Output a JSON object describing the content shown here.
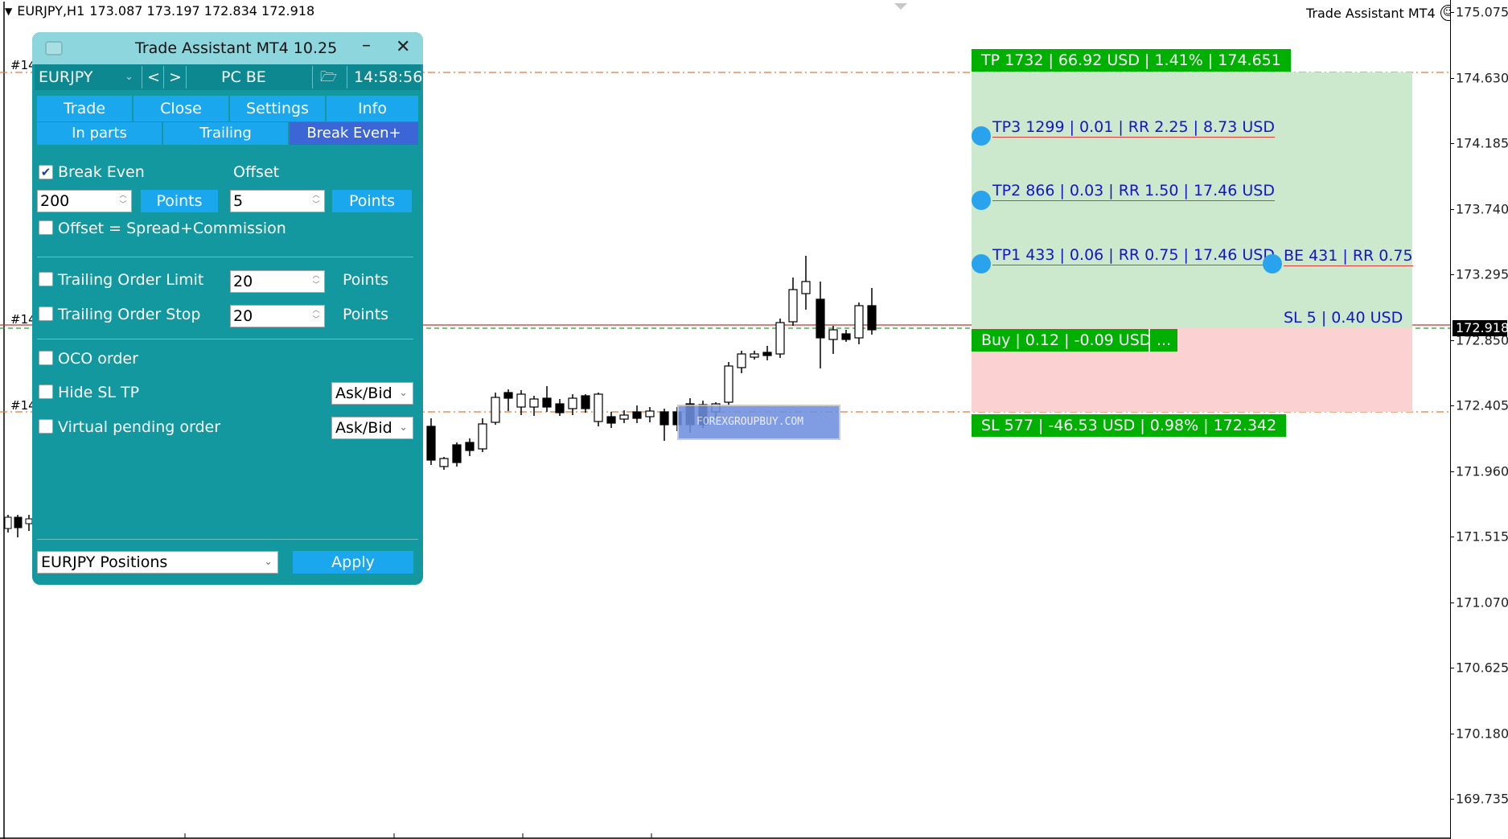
{
  "chart": {
    "header_symbol": "EURJPY,H1",
    "header_ohlc": "173.087 173.197 172.834 172.918",
    "title_right": "Trade Assistant MT4",
    "current_price": "172.918",
    "left_tags": [
      "#14",
      "#14",
      "#14"
    ],
    "price_axis": [
      "175.075",
      "174.630",
      "174.185",
      "173.740",
      "173.295",
      "172.850",
      "172.405",
      "171.960",
      "171.515",
      "171.070",
      "170.625",
      "170.180",
      "169.735"
    ],
    "watermark": "FOREXGROUPBUY.COM",
    "colors": {
      "tp_zone": "#cde9cd",
      "sl_zone": "#fcd1d1",
      "label_green": "#00b000",
      "label_blue_text": "#1515c8",
      "dot": "#29a3ee",
      "level_line": "#e07b3a"
    }
  },
  "orders": {
    "tp": "TP 1732 | 66.92 USD | 1.41% | 174.651",
    "tp3": "TP3 1299 | 0.01 | RR 2.25 | 8.73 USD",
    "tp2": "TP2 866 | 0.03 | RR 1.50 | 17.46 USD",
    "tp1": "TP1 433 | 0.06 | RR 0.75 | 17.46 USD",
    "be": "BE 431 | RR 0.75",
    "sl_small": "SL 5 | 0.40 USD",
    "buy": "Buy | 0.12 | -0.09 USD",
    "buy_more": "...",
    "sl": "SL 577 | -46.53 USD | 0.98% | 172.342"
  },
  "panel": {
    "title": "Trade Assistant MT4 10.25",
    "minimize_icon": "minus",
    "close_icon": "close-x",
    "symbol": "EURJPY",
    "prev": "<",
    "next": ">",
    "mode": "PC BE",
    "time": "14:58:56",
    "tabs": [
      "Trade",
      "Close",
      "Settings",
      "Info"
    ],
    "subtabs": [
      "In parts",
      "Trailing",
      "Break Even+"
    ],
    "active_subtab": "Break Even+",
    "break_even": {
      "label": "Break Even",
      "checked": true,
      "value": "200",
      "unit": "Points"
    },
    "offset": {
      "label": "Offset",
      "value": "5",
      "unit": "Points"
    },
    "offset_spread": {
      "label": "Offset = Spread+Commission",
      "checked": false
    },
    "trailing_limit": {
      "label": "Trailing Order Limit",
      "checked": false,
      "value": "20",
      "unit": "Points"
    },
    "trailing_stop": {
      "label": "Trailing Order Stop",
      "checked": false,
      "value": "20",
      "unit": "Points"
    },
    "oco": {
      "label": "OCO order",
      "checked": false
    },
    "hide_sl_tp": {
      "label": "Hide SL TP",
      "checked": false,
      "select": "Ask/Bid"
    },
    "virtual_pending": {
      "label": "Virtual pending order",
      "checked": false,
      "select": "Ask/Bid"
    },
    "positions_select": "EURJPY Positions",
    "apply": "Apply"
  }
}
